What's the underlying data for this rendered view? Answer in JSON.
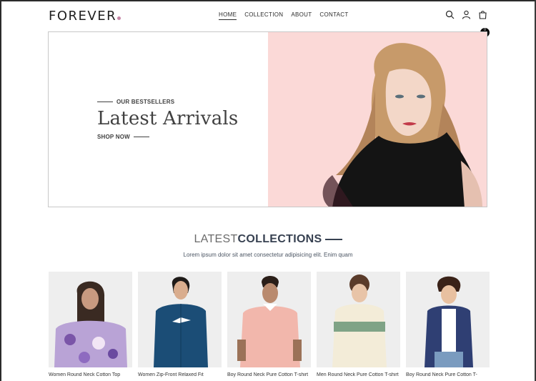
{
  "nav": {
    "logo": "FOREVER",
    "menu": [
      "HOME",
      "COLLECTION",
      "ABOUT",
      "CONTACT"
    ],
    "active": "HOME",
    "icons": [
      "search-icon",
      "user-icon",
      "cart-icon"
    ],
    "cart_count": "0"
  },
  "hero": {
    "tag": "OUR BESTSELLERS",
    "title": "Latest Arrivals",
    "cta": "SHOP NOW",
    "bg_color": "#fbd9d7"
  },
  "section": {
    "title_light": "LATEST",
    "title_dark": "COLLECTIONS",
    "subtitle": "Lorem ipsum dolor sit amet consectetur adipisicing elit. Enim quam"
  },
  "products": [
    {
      "name": "Women Round Neck Cotton Top"
    },
    {
      "name": "Women Zip-Front Relaxed Fit"
    },
    {
      "name": "Boy Round Neck Pure Cotton T-shirt"
    },
    {
      "name": "Men Round Neck Pure Cotton T-shirt"
    },
    {
      "name": "Boy Round Neck Pure Cotton T-"
    }
  ]
}
